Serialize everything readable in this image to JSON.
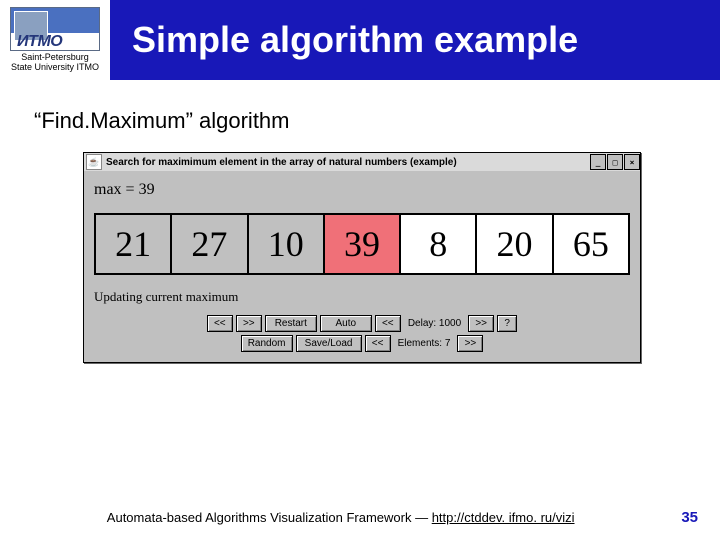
{
  "header": {
    "org_line1": "Saint-Petersburg",
    "org_line2": "State University ITMO",
    "title": "Simple algorithm example"
  },
  "content": {
    "subtitle": "“Find.Maximum” algorithm"
  },
  "app": {
    "window_title": "Search for maximimum element in the array of natural numbers (example)",
    "max_label": "max = 39",
    "cells": [
      "21",
      "27",
      "10",
      "39",
      "8",
      "20",
      "65"
    ],
    "highlight_index": 3,
    "white_indices": [
      4,
      5,
      6
    ],
    "status_text": "Updating current maximum",
    "row1": {
      "back": "<<",
      "fwd": ">>",
      "restart": "Restart",
      "auto": "Auto",
      "back2": "<<",
      "delay_label": "Delay: 1000",
      "fwd2": ">>",
      "help": "?"
    },
    "row2": {
      "random": "Random",
      "saveload": "Save/Load",
      "back": "<<",
      "elements_label": "Elements: 7",
      "fwd": ">>"
    }
  },
  "footer": {
    "text_prefix": "Automata-based Algorithms Visualization Framework — ",
    "link": "http://ctddev. ifmo. ru/vizi",
    "page": "35"
  }
}
